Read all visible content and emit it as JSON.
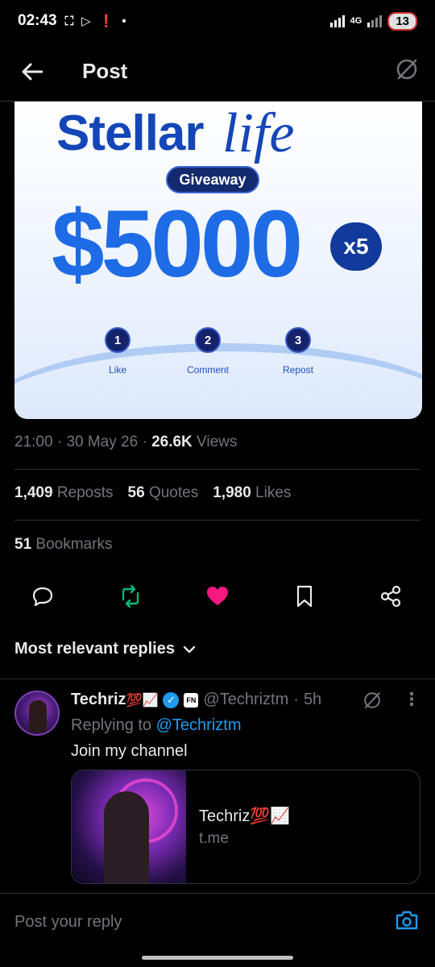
{
  "status": {
    "time": "02:43",
    "network": "4G",
    "battery": "13"
  },
  "header": {
    "title": "Post"
  },
  "media": {
    "brand": "Stellar",
    "brand_script": "life",
    "badge": "Giveaway",
    "amount": "$5000",
    "multiplier": "x5",
    "steps": [
      {
        "num": "1",
        "label": "Like"
      },
      {
        "num": "2",
        "label": "Comment"
      },
      {
        "num": "3",
        "label": "Repost"
      }
    ]
  },
  "meta": {
    "time": "21:00",
    "date": "30 May 26",
    "views_count": "26.6K",
    "views_label": "Views"
  },
  "stats": {
    "reposts_count": "1,409",
    "reposts_label": "Reposts",
    "quotes_count": "56",
    "quotes_label": "Quotes",
    "likes_count": "1,980",
    "likes_label": "Likes",
    "bookmarks_count": "51",
    "bookmarks_label": "Bookmarks"
  },
  "actions": {
    "icons": [
      "reply-icon",
      "repost-icon",
      "like-icon",
      "bookmark-icon",
      "share-icon"
    ],
    "colors": {
      "repost": "#00ba7c",
      "like": "#f91880"
    }
  },
  "replies": {
    "sort_label": "Most relevant replies"
  },
  "reply": {
    "name": "Techriz",
    "name_emoji": "💯📈",
    "affiliate_badge": "FN",
    "handle": "@Techriztm",
    "dot": "·",
    "age": "5h",
    "replying_prefix": "Replying to",
    "replying_handle": "@Techriztm",
    "text": "Join my channel",
    "card": {
      "title": "Techriz💯📈",
      "domain": "t.me"
    }
  },
  "composer": {
    "placeholder": "Post your reply"
  },
  "colors": {
    "background": "#000000",
    "accent": "#1d9bf0",
    "muted": "#71767b",
    "divider": "#2f3336"
  }
}
